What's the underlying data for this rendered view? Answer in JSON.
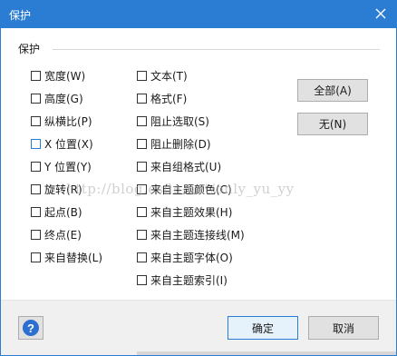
{
  "window": {
    "title": "保护"
  },
  "group": {
    "title": "保护"
  },
  "left_options": [
    {
      "label": "宽度(W)",
      "checked": false
    },
    {
      "label": "高度(G)",
      "checked": false
    },
    {
      "label": "纵横比(P)",
      "checked": false
    },
    {
      "label": "X 位置(X)",
      "checked": false
    },
    {
      "label": "Y 位置(Y)",
      "checked": false
    },
    {
      "label": "旋转(R)",
      "checked": false
    },
    {
      "label": "起点(B)",
      "checked": false
    },
    {
      "label": "终点(E)",
      "checked": false
    },
    {
      "label": "来自替换(L)",
      "checked": false
    }
  ],
  "right_options": [
    {
      "label": "文本(T)",
      "checked": false
    },
    {
      "label": "格式(F)",
      "checked": false
    },
    {
      "label": "阻止选取(S)",
      "checked": false
    },
    {
      "label": "阻止删除(D)",
      "checked": false
    },
    {
      "label": "来自组格式(U)",
      "checked": false
    },
    {
      "label": "来自主题颜色(C)",
      "checked": false
    },
    {
      "label": "来自主题效果(H)",
      "checked": false
    },
    {
      "label": "来自主题连接线(M)",
      "checked": false
    },
    {
      "label": "来自主题字体(O)",
      "checked": false
    },
    {
      "label": "来自主题索引(I)",
      "checked": false
    }
  ],
  "buttons": {
    "all": "全部(A)",
    "none": "无(N)",
    "ok": "确定",
    "cancel": "取消"
  },
  "watermark": "http://blog.csdn.net/only_yu_yy",
  "colors": {
    "titlebar": "#2b7cd3",
    "help_icon": "#2c6fd1"
  }
}
